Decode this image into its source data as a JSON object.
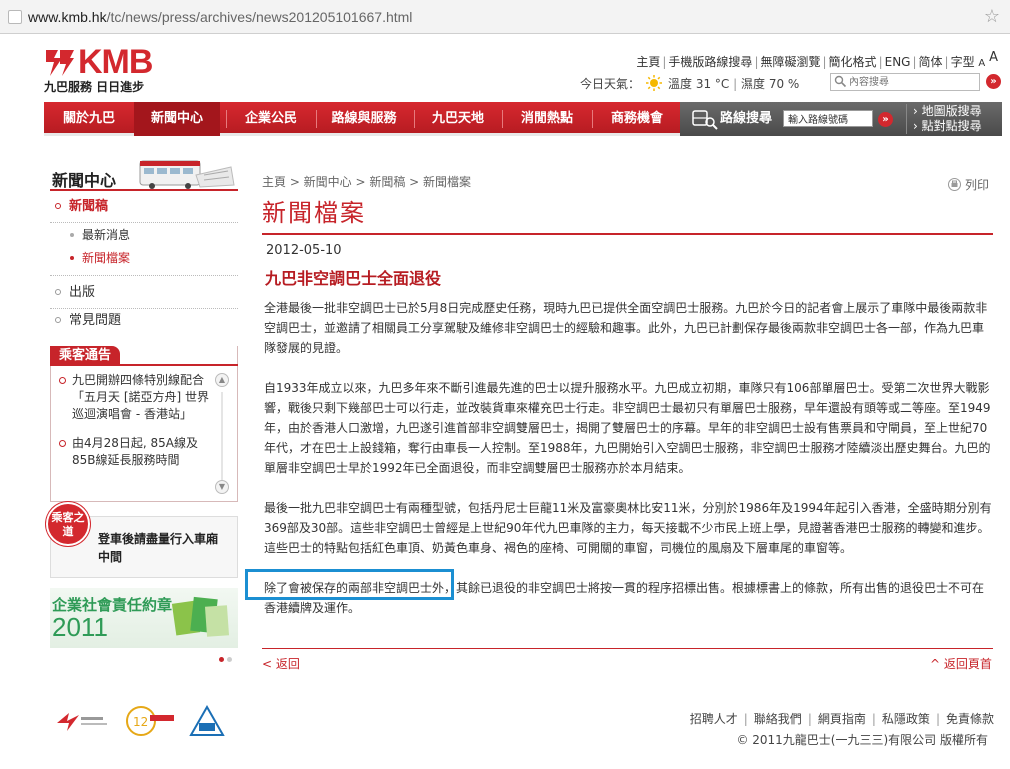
{
  "browser": {
    "url_host": "www.kmb.hk",
    "url_path": "/tc/news/press/archives/news201205101667.html"
  },
  "header": {
    "brand": "KMB",
    "slogan": "九巴服務 日日進步",
    "toplinks": [
      "主頁",
      "手機版路線搜尋",
      "無障礙瀏覽",
      "簡化格式",
      "ENG",
      "简体"
    ],
    "font_label": "字型",
    "font_small": "A",
    "font_big": "A",
    "weather_label": "今日天氣：",
    "temperature": "溫度 31 °C",
    "humidity": "濕度 70 %",
    "search_placeholder": "內容搜尋",
    "accent_color": "#d3282e"
  },
  "nav": {
    "items": [
      {
        "label": "關於九巴",
        "active": false
      },
      {
        "label": "新聞中心",
        "active": true
      },
      {
        "label": "企業公民",
        "active": false
      },
      {
        "label": "路線與服務",
        "active": false
      },
      {
        "label": "九巴天地",
        "active": false
      },
      {
        "label": "消閒熱點",
        "active": false
      },
      {
        "label": "商務機會",
        "active": false
      }
    ],
    "route_search_label": "路線搜尋",
    "route_input_value": "輸入路線號碼",
    "map_search": "地圖版搜尋",
    "point_search": "點對點搜尋"
  },
  "sidebar": {
    "title": "新聞中心",
    "menu": {
      "press": "新聞稿",
      "latest": "最新消息",
      "archive": "新聞檔案",
      "publications": "出版",
      "faq": "常見問題"
    },
    "notice_title": "乘客通告",
    "notices": [
      "九巴開辦四條特別線配合「五月天 [諾亞方舟] 世界巡迴演唱會 - 香港站」",
      "由4月28日起, 85A線及85B線延長服務時間"
    ],
    "guide_badge": "乘客之道",
    "guide_text": "登車後請盡量行入車廂中間",
    "csr_title": "企業社會責任約章",
    "csr_year": "2011"
  },
  "content": {
    "breadcrumb": "主頁 > 新聞中心 > 新聞稿 > 新聞檔案",
    "print": "列印",
    "page_title": "新聞檔案",
    "date": "2012-05-10",
    "headline": "九巴非空調巴士全面退役",
    "paragraphs": [
      "全港最後一批非空調巴士已於5月8日完成歷史任務，現時九巴已提供全面空調巴士服務。九巴於今日的記者會上展示了車隊中最後兩款非空調巴士，並邀請了相關員工分享駕駛及維修非空調巴士的經驗和趣事。此外，九巴已計劃保存最後兩款非空調巴士各一部，作為九巴車隊發展的見證。",
      "自1933年成立以來，九巴多年來不斷引進最先進的巴士以提升服務水平。九巴成立初期，車隊只有106部單層巴士。受第二次世界大戰影響，戰後只剩下幾部巴士可以行走，並改裝貨車來權充巴士行走。非空調巴士最初只有單層巴士服務，早年還設有頭等或二等座。至1949年，由於香港人口激增，九巴遂引進首部非空調雙層巴士，揭開了雙層巴士的序幕。早年的非空調巴士設有售票員和守閘員，至上世紀70年代，才在巴士上設錢箱，奪行由車長一人控制。至1988年，九巴開始引入空調巴士服務，非空調巴士服務才陸續淡出歷史舞台。九巴的單層非空調巴士早於1992年已全面退役，而非空調雙層巴士服務亦於本月結束。",
      "最後一批九巴非空調巴士有兩種型號，包括丹尼士巨龍11米及富豪奧林比安11米，分別於1986年及1994年起引入香港，全盛時期分別有369部及30部。這些非空調巴士曾經是上世紀90年代九巴車隊的主力，每天接載不少市民上班上學，見證著香港巴士服務的轉變和進步。這些巴士的特點包括紅色車頂、奶黃色車身、褐色的座椅、可開關的車窗，司機位的風扇及下層車尾的車窗等。",
      "除了會被保存的兩部非空調巴士外，其餘已退役的非空調巴士將按一貫的程序招標出售。根據標書上的條款，所有出售的退役巴士不可在香港續牌及運作。"
    ],
    "back": "< 返回",
    "back_top": "^ 返回頁首"
  },
  "footer": {
    "links": [
      "招聘人才",
      "聯絡我們",
      "網頁指南",
      "私隱政策",
      "免責條款"
    ],
    "copyright": "© 2011九龍巴士(一九三三)有限公司 版權所有"
  }
}
